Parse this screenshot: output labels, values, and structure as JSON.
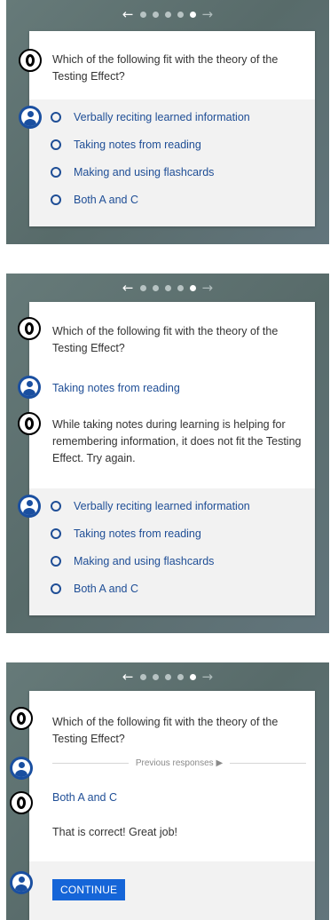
{
  "nav": {
    "back_arrow": "←",
    "forward_arrow": "→",
    "dot_count": 6,
    "active_dot": 5
  },
  "question": "Which of the following fit with the theory of the Testing Effect?",
  "options": [
    "Verbally reciting learned information",
    "Taking notes from reading",
    "Making and using flashcards",
    "Both A and C"
  ],
  "panel2": {
    "user_answer": "Taking notes from reading",
    "feedback": "While taking notes during learning is helping for remembering information, it does not fit the Testing Effect. Try again."
  },
  "panel3": {
    "previous_responses": "Previous responses ▶",
    "user_answer": "Both A and C",
    "feedback": "That is correct! Great job!",
    "continue_label": "CONTINUE"
  },
  "colors": {
    "link_blue": "#1f4e96",
    "button_blue": "#1565d8",
    "panel_bg": "#5e7170"
  },
  "icons": {
    "bot": "bot-avatar-icon",
    "user": "user-avatar-icon",
    "radio": "radio-icon"
  }
}
